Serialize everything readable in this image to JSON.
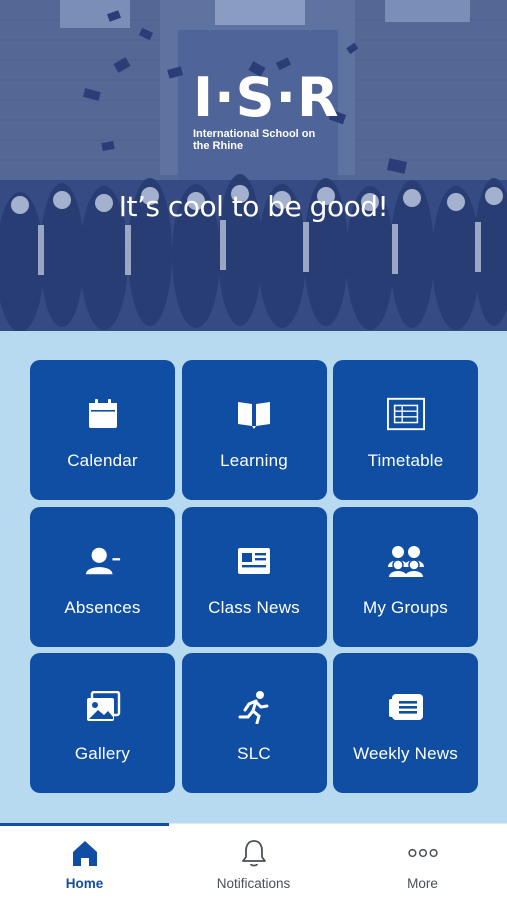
{
  "hero": {
    "logo_text": "I·S·R",
    "logo_subtitle": "International School on the Rhine",
    "slogan": "It’s cool to be good!"
  },
  "tiles": [
    {
      "label": "Calendar",
      "icon": "calendar-icon"
    },
    {
      "label": "Learning",
      "icon": "book-icon"
    },
    {
      "label": "Timetable",
      "icon": "timetable-icon"
    },
    {
      "label": "Absences",
      "icon": "person-minus-icon"
    },
    {
      "label": "Class News",
      "icon": "newspaper-icon"
    },
    {
      "label": "My Groups",
      "icon": "group-icon"
    },
    {
      "label": "Gallery",
      "icon": "gallery-icon"
    },
    {
      "label": "SLC",
      "icon": "running-person-icon"
    },
    {
      "label": "Weekly News",
      "icon": "news-card-icon"
    }
  ],
  "tabbar": {
    "items": [
      {
        "label": "Home",
        "icon": "home-icon",
        "active": true
      },
      {
        "label": "Notifications",
        "icon": "bell-icon",
        "active": false
      },
      {
        "label": "More",
        "icon": "more-dots-icon",
        "active": false
      }
    ]
  },
  "colors": {
    "tile": "#0f4ea3",
    "background": "#b7daf0",
    "active_tab": "#0f4ea3"
  }
}
